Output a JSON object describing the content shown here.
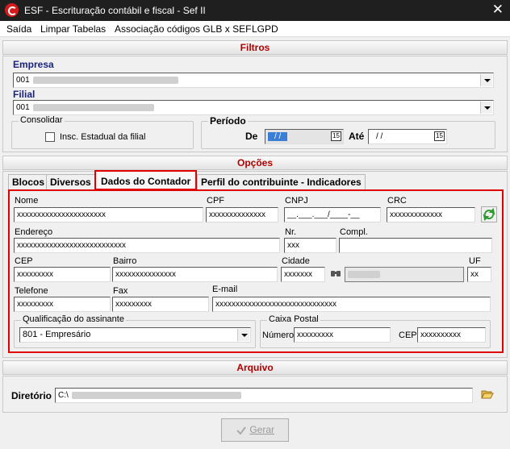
{
  "window": {
    "title": "ESF - Escrituração contábil e fiscal - Sef II",
    "close_glyph": "✕"
  },
  "menu": [
    "Saída",
    "Limpar Tabelas",
    "Associação códigos GLB x SEF",
    "LGPD"
  ],
  "filtros": {
    "header": "Filtros",
    "empresa_label": "Empresa",
    "empresa_value": "001",
    "filial_label": "Filial",
    "filial_value": "001",
    "consolidar_label": "Consolidar",
    "insc_label": "Insc. Estadual da filial",
    "periodo_label": "Período",
    "de_label": "De",
    "de_value": "/ /",
    "ate_label": "Até",
    "ate_value": "/ /",
    "cal_glyph": "15"
  },
  "opcoes": {
    "header": "Opções",
    "tabs": [
      "Blocos",
      "Diversos",
      "Dados do Contador",
      "Perfil do contribuinte - Indicadores"
    ],
    "active_tab": 2
  },
  "contador": {
    "nome_label": "Nome",
    "nome_value": "xxxxxxxxxxxxxxxxxxxxxx",
    "cpf_label": "CPF",
    "cpf_value": "xxxxxxxxxxxxxx",
    "cnpj_label": "CNPJ",
    "cnpj_value": "__.___.___/____-__",
    "crc_label": "CRC",
    "crc_value": "xxxxxxxxxxxxx",
    "endereco_label": "Endereço",
    "endereco_value": "xxxxxxxxxxxxxxxxxxxxxxxxxxx",
    "nr_label": "Nr.",
    "nr_value": "xxx",
    "compl_label": "Compl.",
    "compl_value": "",
    "cep_label": "CEP",
    "cep_value": "xxxxxxxxx",
    "bairro_label": "Bairro",
    "bairro_value": "xxxxxxxxxxxxxxx",
    "cidade_label": "Cidade",
    "cidade_value": "xxxxxxx",
    "uf_label": "UF",
    "uf_value": "xx",
    "telefone_label": "Telefone",
    "telefone_value": "xxxxxxxxx",
    "fax_label": "Fax",
    "fax_value": "xxxxxxxxx",
    "email_label": "E-mail",
    "email_value": "xxxxxxxxxxxxxxxxxxxxxxxxxxxxxx",
    "qualif_label": "Qualificação do assinante",
    "qualif_value": "801 - Empresário",
    "caixa_label": "Caixa Postal",
    "numero_label": "Número",
    "numero_value": "xxxxxxxxx",
    "cp_cep_label": "CEP",
    "cp_cep_value": "xxxxxxxxxx"
  },
  "arquivo": {
    "header": "Arquivo",
    "diretorio_label": "Diretório",
    "diretorio_value": "C:\\"
  },
  "gerar_label": "Gerar",
  "colors": {
    "red_accent": "#e00000",
    "section_text": "#b00000",
    "label_blue": "#1a237e"
  }
}
